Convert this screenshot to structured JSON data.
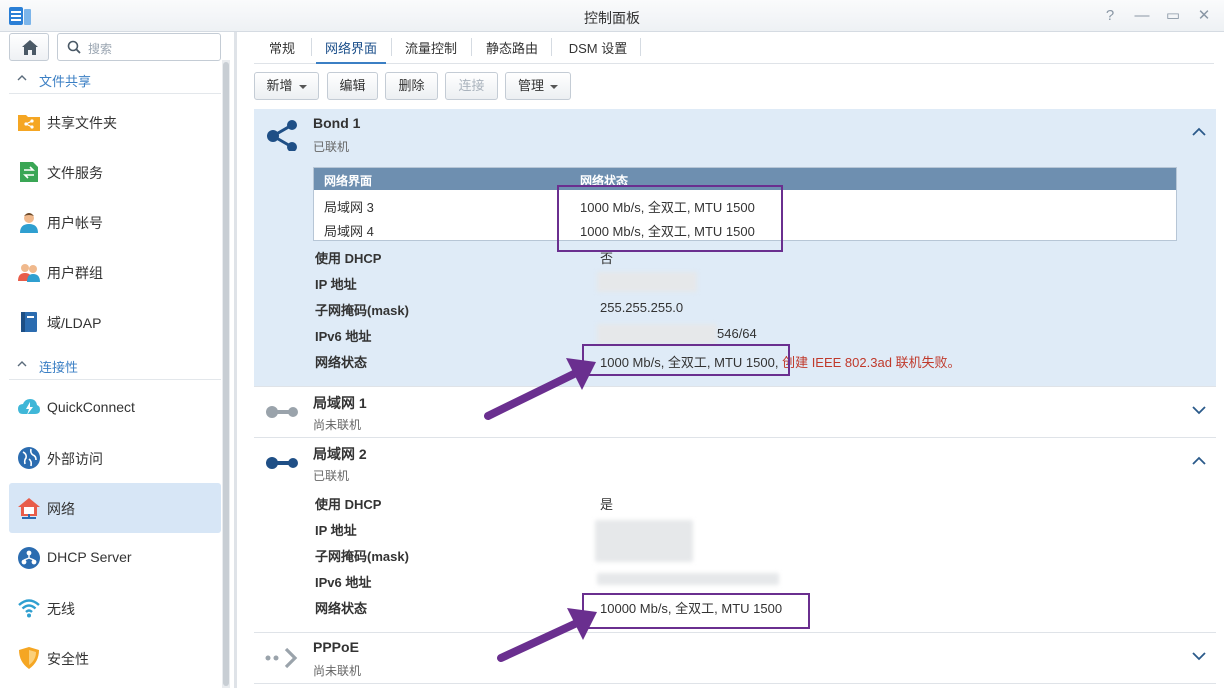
{
  "window": {
    "title": "控制面板",
    "buttons": {
      "help": "?",
      "minimize": "—",
      "maximize": "▭",
      "close": "✕"
    }
  },
  "sidebar": {
    "search_placeholder": "搜索",
    "sections": [
      {
        "label": "文件共享"
      },
      {
        "label": "连接性"
      }
    ],
    "items": [
      {
        "label": "共享文件夹",
        "icon": "shared-folder-icon"
      },
      {
        "label": "文件服务",
        "icon": "file-services-icon"
      },
      {
        "label": "用户帐号",
        "icon": "user-icon"
      },
      {
        "label": "用户群组",
        "icon": "group-icon"
      },
      {
        "label": "域/LDAP",
        "icon": "domain-ldap-icon"
      },
      {
        "label": "QuickConnect",
        "icon": "quickconnect-icon"
      },
      {
        "label": "外部访问",
        "icon": "external-access-icon"
      },
      {
        "label": "网络",
        "icon": "network-icon",
        "active": true
      },
      {
        "label": "DHCP Server",
        "icon": "dhcp-server-icon"
      },
      {
        "label": "无线",
        "icon": "wireless-icon"
      },
      {
        "label": "安全性",
        "icon": "security-icon"
      }
    ]
  },
  "tabs": [
    {
      "label": "常规"
    },
    {
      "label": "网络界面",
      "active": true
    },
    {
      "label": "流量控制"
    },
    {
      "label": "静态路由"
    },
    {
      "label": "DSM 设置"
    }
  ],
  "toolbar": {
    "create": "新增",
    "edit": "编辑",
    "delete": "删除",
    "connect": "连接",
    "manage": "管理"
  },
  "interfaces": {
    "bond1": {
      "name": "Bond 1",
      "status": "已联机",
      "table": {
        "headers": [
          "网络界面",
          "网络状态"
        ],
        "rows": [
          [
            "局域网 3",
            "1000 Mb/s, 全双工, MTU 1500"
          ],
          [
            "局域网 4",
            "1000 Mb/s, 全双工, MTU 1500"
          ]
        ]
      },
      "labels": {
        "dhcp": "使用 DHCP",
        "ip": "IP 地址",
        "mask": "子网掩码(mask)",
        "ipv6": "IPv6 地址",
        "net_status": "网络状态"
      },
      "values": {
        "dhcp": "否",
        "mask": "255.255.255.0",
        "ipv6_suffix": "546/64",
        "net_status": "1000 Mb/s, 全双工, MTU 1500, ",
        "net_status_error": "创建 IEEE 802.3ad 联机失败。"
      }
    },
    "lan1": {
      "name": "局域网 1",
      "status": "尚未联机"
    },
    "lan2": {
      "name": "局域网 2",
      "status": "已联机",
      "labels": {
        "dhcp": "使用 DHCP",
        "ip": "IP 地址",
        "mask": "子网掩码(mask)",
        "ipv6": "IPv6 地址",
        "net_status": "网络状态"
      },
      "values": {
        "dhcp": "是",
        "net_status": "10000 Mb/s, 全双工, MTU 1500"
      }
    },
    "pppoe": {
      "name": "PPPoE",
      "status": "尚未联机"
    }
  },
  "colors": {
    "accent": "#3b7fc4",
    "expanded_panel": "#dfebf7",
    "grid_header": "#6e8fb0",
    "error_text": "#c0392b",
    "annotation": "#6a2f8f"
  }
}
